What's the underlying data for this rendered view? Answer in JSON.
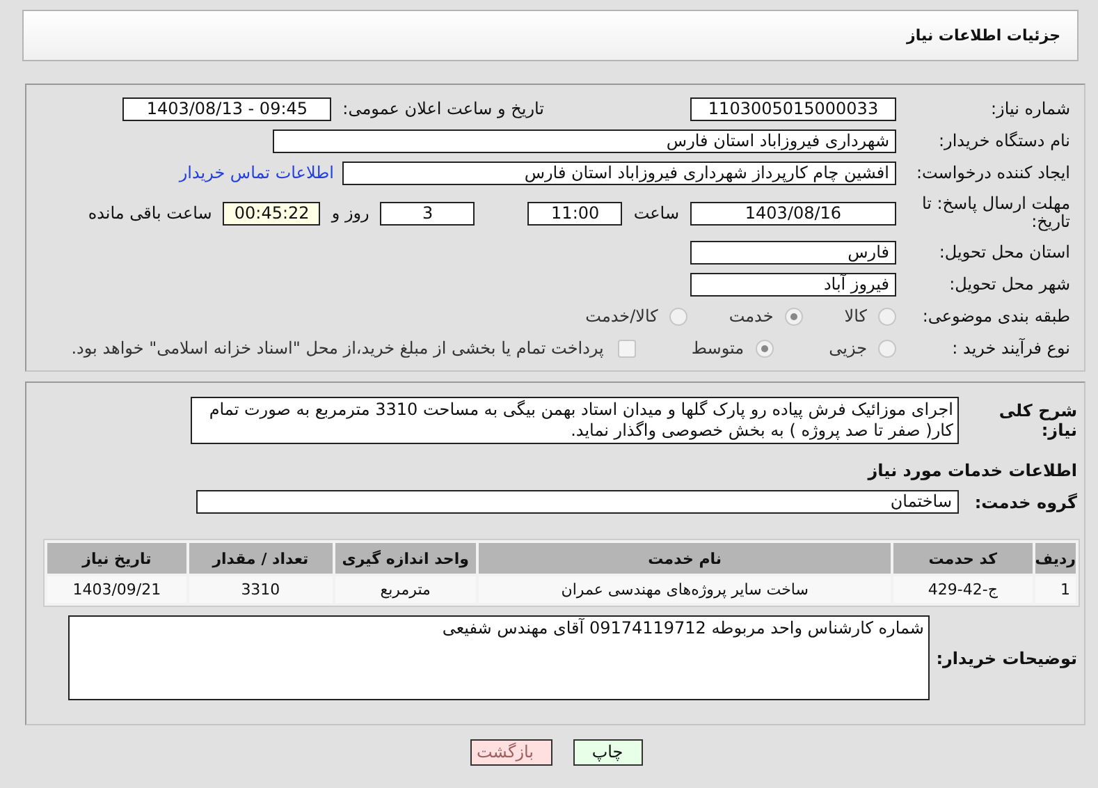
{
  "header": {
    "title": "جزئیات اطلاعات نیاز"
  },
  "details": {
    "need_number": {
      "label": "شماره نیاز:",
      "value": "1103005015000033"
    },
    "announce": {
      "label": "تاریخ و ساعت اعلان عمومی:",
      "value": "1403/08/13 - 09:45"
    },
    "buyer": {
      "label": "نام دستگاه خریدار:",
      "value": "شهرداری فیروزاباد استان فارس"
    },
    "creator": {
      "label": "ایجاد کننده درخواست:",
      "value": "افشین چام کارپرداز شهرداری فیروزاباد استان فارس",
      "link": "اطلاعات تماس خریدار"
    },
    "deadline": {
      "label": "مهلت ارسال پاسخ: تا تاریخ:",
      "date": "1403/08/16",
      "time_label": "ساعت",
      "time": "11:00",
      "days": "3",
      "days_label": "روز و",
      "remaining": "00:45:22",
      "remaining_label": "ساعت باقی مانده"
    },
    "province": {
      "label": "استان محل تحویل:",
      "value": "فارس"
    },
    "city": {
      "label": "شهر محل تحویل:",
      "value": "فیروز آباد"
    },
    "category": {
      "label": "طبقه بندی موضوعی:",
      "options": [
        {
          "label": "کالا",
          "selected": false
        },
        {
          "label": "خدمت",
          "selected": true
        },
        {
          "label": "کالا/خدمت",
          "selected": false
        }
      ]
    },
    "process": {
      "label": "نوع فرآیند خرید :",
      "options": [
        {
          "label": "جزیی",
          "selected": false
        },
        {
          "label": "متوسط",
          "selected": true
        }
      ],
      "treasury": {
        "label": "پرداخت تمام یا بخشی از مبلغ خرید،از محل \"اسناد خزانه اسلامی\" خواهد بود.",
        "checked": false
      }
    }
  },
  "services": {
    "description": {
      "label": "شرح کلی نیاز:",
      "value": "اجرای موزائیک  فرش پیاده رو  پارک گلها و میدان استاد بهمن بیگی  به مساحت 3310 مترمربع  به صورت تمام کار( صفر تا صد پروژه ) به بخش خصوصی واگذار نماید."
    },
    "heading": "اطلاعات خدمات مورد نیاز",
    "group": {
      "label": "گروه خدمت:",
      "value": "ساختمان"
    },
    "table": {
      "columns": [
        "ردیف",
        "کد حدمت",
        "نام خدمت",
        "واحد اندازه گیری",
        "تعداد / مقدار",
        "تاریخ نیاز"
      ],
      "rows": [
        [
          "1",
          "ج-42-429",
          "ساخت سایر پروژه‌های مهندسی عمران",
          "مترمربع",
          "3310",
          "1403/09/21"
        ]
      ]
    },
    "buyer_notes": {
      "label": "توضیحات خریدار:",
      "value": "شماره کارشناس واحد مربوطه 09174119712 آقای مهندس شفیعی"
    }
  },
  "buttons": [
    {
      "kind": "print",
      "label": "چاپ"
    },
    {
      "kind": "back",
      "label": "بازگشت"
    }
  ]
}
